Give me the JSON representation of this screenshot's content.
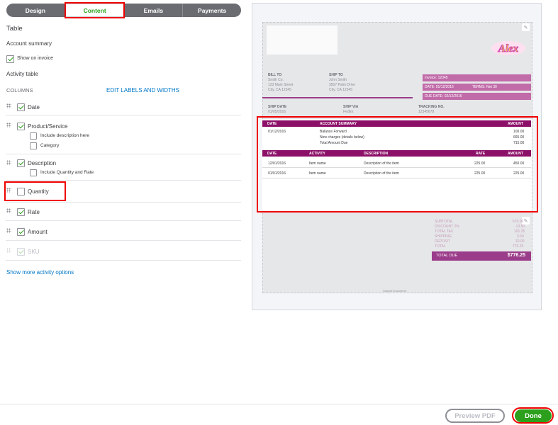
{
  "tabs": [
    {
      "label": "Design"
    },
    {
      "label": "Content"
    },
    {
      "label": "Emails"
    },
    {
      "label": "Payments"
    }
  ],
  "panel": {
    "heading": "Table",
    "account_summary": "Account summary",
    "show_on_invoice": "Show on invoice",
    "activity_table": "Activity table",
    "columns_label": "COLUMNS",
    "edit_labels_link": "EDIT LABELS AND WIDTHS",
    "columns": [
      {
        "label": "Date",
        "checked": true
      },
      {
        "label": "Product/Service",
        "checked": true
      },
      {
        "label": "Include description here",
        "checked": false
      },
      {
        "label": "Category",
        "checked": false
      },
      {
        "label": "Description",
        "checked": true
      },
      {
        "label": "Include Quantity and Rate",
        "checked": false
      },
      {
        "label": "Quantity",
        "checked": false
      },
      {
        "label": "Rate",
        "checked": true
      },
      {
        "label": "Amount",
        "checked": true
      },
      {
        "label": "SKU",
        "checked": true
      }
    ],
    "show_more_link": "Show more activity options"
  },
  "preview": {
    "logo_text": "Alex",
    "bill_to": {
      "label": "BILL TO",
      "lines": [
        "Smith Co.",
        "123 Main Street",
        "City, CA 12345"
      ]
    },
    "ship_to": {
      "label": "SHIP TO",
      "lines": [
        "John Smith",
        "3507 Palm Drive",
        "City, CA 12345"
      ]
    },
    "invoice_no": "Invoice: 12345",
    "date_line": "DATE: 01/12/2016",
    "terms": "TERMS: Net 30",
    "due_date": "DUE DATE: 02/12/2016",
    "ship_date": {
      "label": "SHIP DATE",
      "value": "01/05/2016"
    },
    "ship_via": {
      "label": "SHIP VIA",
      "value": "FedEx"
    },
    "tracking": {
      "label": "TRACKING NO.",
      "value": "12345678"
    },
    "summary_headers": {
      "date": "DATE",
      "account_summary": "ACCOUNT SUMMARY",
      "amount": "AMOUNT"
    },
    "summary_rows": [
      {
        "date": "01/12/2016",
        "desc": "Balance Forward",
        "amount": "100.00"
      },
      {
        "date": "",
        "desc": "New charges (details below)",
        "amount": "665.00"
      },
      {
        "date": "",
        "desc": "Total Amount Due",
        "amount": "715.00"
      }
    ],
    "activity_headers": {
      "date": "DATE",
      "activity": "ACTIVITY",
      "description": "DESCRIPTION",
      "rate": "RATE",
      "amount": "AMOUNT"
    },
    "activity_rows": [
      {
        "date": "12/01/2016",
        "activity": "Item name",
        "description": "Description of the item",
        "rate": "225.00",
        "amount": "450.00"
      },
      {
        "date": "01/01/2016",
        "activity": "Item name",
        "description": "Description of the item",
        "rate": "225.00",
        "amount": "225.00"
      }
    ],
    "totals": [
      {
        "label": "SUBTOTAL",
        "value": "675.00"
      },
      {
        "label": "DISCOUNT 2%",
        "value": "-13.50"
      },
      {
        "label": "TOTAL TAX",
        "value": "101.25"
      },
      {
        "label": "SHIPPING",
        "value": "3.50"
      },
      {
        "label": "DEPOSIT",
        "value": "10.00"
      },
      {
        "label": "TOTAL",
        "value": "776.25"
      }
    ],
    "total_due_label": "TOTAL DUE",
    "total_due_value": "$776.25",
    "footer_note": "Sample Document"
  },
  "footer": {
    "preview_pdf": "Preview PDF",
    "done": "Done"
  },
  "colors": {
    "accent_green": "#2ca01c",
    "invoice_purple": "#8c0f68",
    "highlight_red": "#e00000"
  }
}
